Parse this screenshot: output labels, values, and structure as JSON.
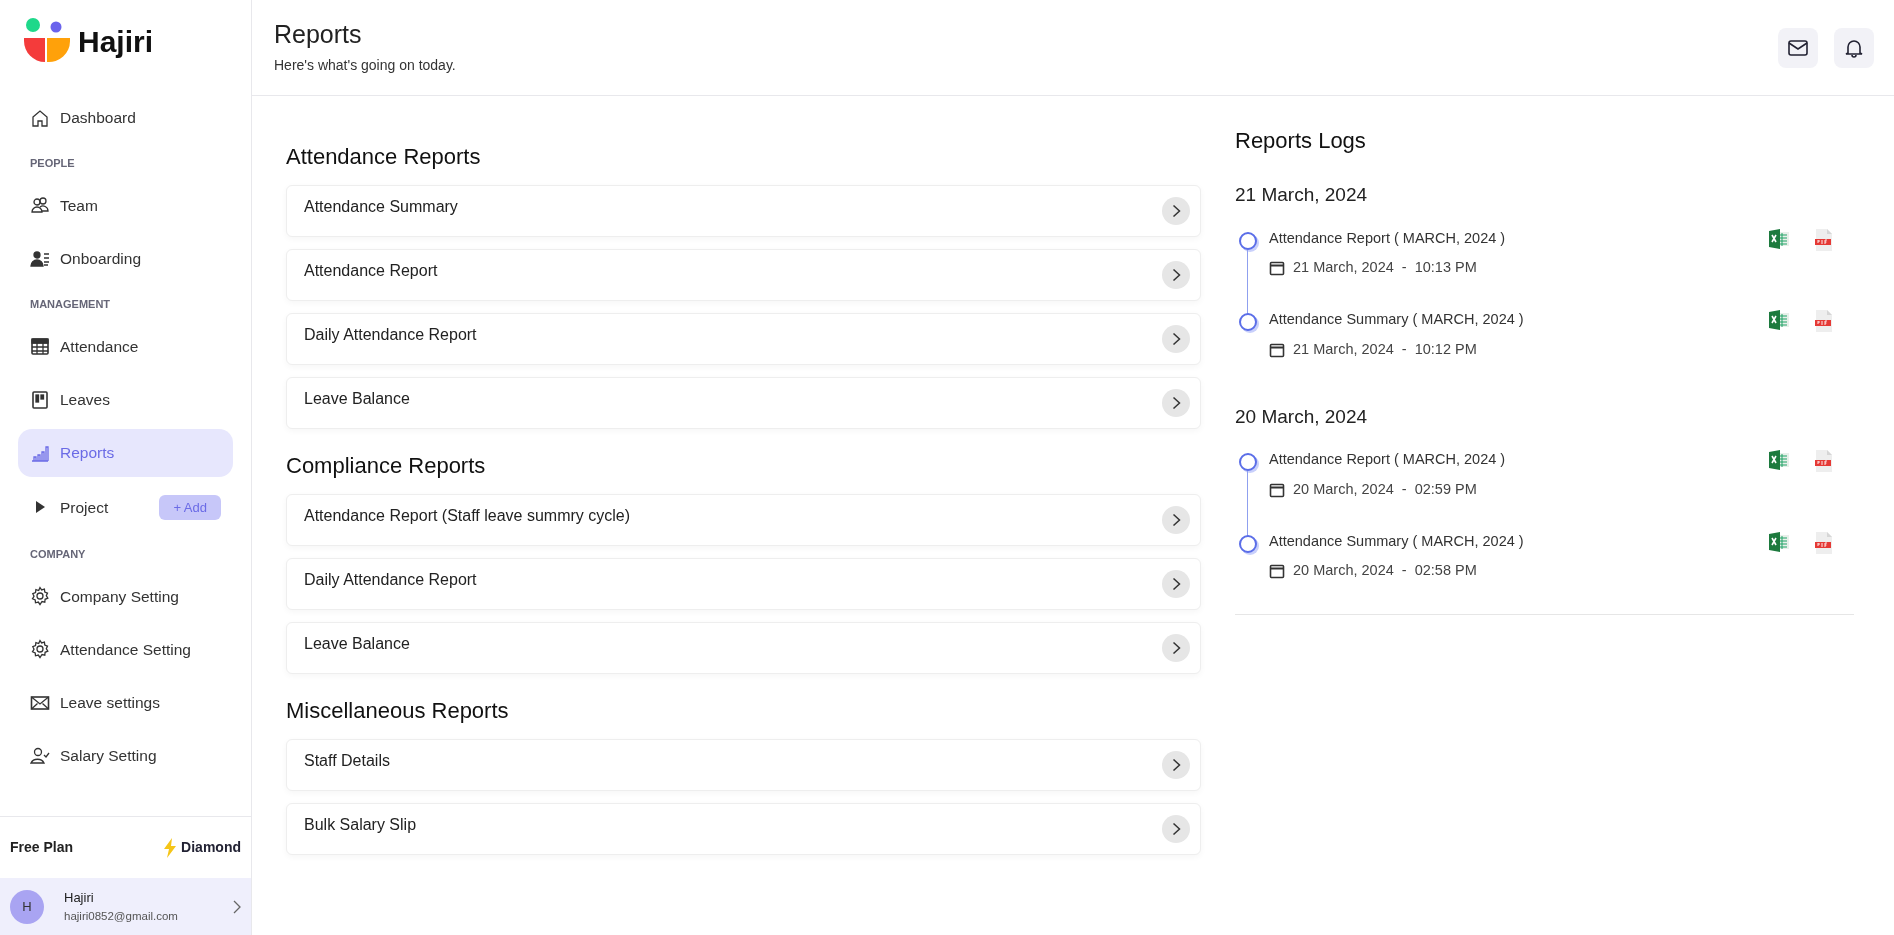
{
  "brand": {
    "name": "Hajiri"
  },
  "sidebar": {
    "sections": [
      {
        "items": [
          {
            "label": "Dashboard",
            "selected": false
          }
        ]
      },
      {
        "heading": "PEOPLE",
        "items": [
          {
            "label": "Team",
            "selected": false
          },
          {
            "label": "Onboarding",
            "selected": false
          }
        ]
      },
      {
        "heading": "MANAGEMENT",
        "items": [
          {
            "label": "Attendance",
            "selected": false
          },
          {
            "label": "Leaves",
            "selected": false
          },
          {
            "label": "Reports",
            "selected": true
          },
          {
            "label": "Project",
            "selected": false,
            "action": "+ Add"
          }
        ]
      },
      {
        "heading": "COMPANY",
        "items": [
          {
            "label": "Company Setting",
            "selected": false
          },
          {
            "label": "Attendance Setting",
            "selected": false
          },
          {
            "label": "Leave settings",
            "selected": false
          },
          {
            "label": "Salary Setting",
            "selected": false
          }
        ]
      }
    ],
    "plan": {
      "label": "Free Plan",
      "tier": "Diamond"
    },
    "user": {
      "initial": "H",
      "name": "Hajiri",
      "email": "hajiri0852@gmail.com"
    }
  },
  "header": {
    "title": "Reports",
    "subtitle": "Here's what's going on today."
  },
  "report_groups": [
    {
      "title": "Attendance Reports",
      "items": [
        "Attendance Summary",
        "Attendance Report",
        "Daily Attendance Report",
        "Leave Balance"
      ]
    },
    {
      "title": "Compliance Reports",
      "items": [
        "Attendance Report (Staff leave summry cycle)",
        "Daily Attendance Report",
        "Leave Balance"
      ]
    },
    {
      "title": "Miscellaneous Reports",
      "items": [
        "Staff Details",
        "Bulk Salary Slip"
      ]
    }
  ],
  "logs": {
    "title": "Reports Logs",
    "days": [
      {
        "date": "21 March, 2024",
        "entries": [
          {
            "name": "Attendance Report ( MARCH, 2024 )",
            "timestamp": "21 March, 2024  -  10:13 PM"
          },
          {
            "name": "Attendance Summary ( MARCH, 2024 )",
            "timestamp": "21 March, 2024  -  10:12 PM"
          }
        ]
      },
      {
        "date": "20 March, 2024",
        "entries": [
          {
            "name": "Attendance Report ( MARCH, 2024 )",
            "timestamp": "20 March, 2024  -  02:59 PM"
          },
          {
            "name": "Attendance Summary ( MARCH, 2024 )",
            "timestamp": "20 March, 2024  -  02:58 PM"
          }
        ]
      }
    ]
  }
}
